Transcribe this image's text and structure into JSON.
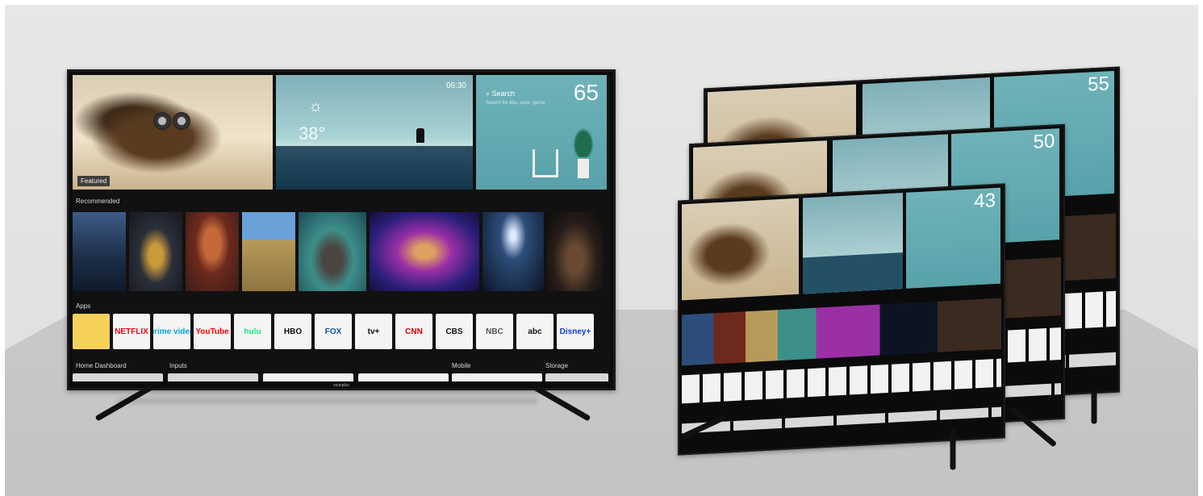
{
  "main_tv": {
    "hero_badge": "Featured",
    "weather_time": "06:30",
    "weather_temp": "38°",
    "search_label": "Search",
    "search_hint": "Search for title, actor, genre",
    "size": "65",
    "recommended_label": "Recommended",
    "apps_label": "Apps",
    "apps": [
      "",
      "NETFLIX",
      "prime video",
      "YouTube",
      "hulu",
      "HBO",
      "FOX",
      "tv+",
      "CNN",
      "CBS",
      "NBC",
      "abc",
      "Disney+"
    ],
    "bottom": {
      "home": "Home Dashboard",
      "inputs": "Inputs",
      "mobile": "Mobile",
      "storage": "Storage"
    },
    "brand": "vsunplus"
  },
  "stacked_tvs": [
    {
      "size": "55"
    },
    {
      "size": "50"
    },
    {
      "size": "43"
    }
  ],
  "colors": {
    "tile_teal": "#58a2aa",
    "bezel": "#0b0b0b",
    "background": "#e3e3e3"
  }
}
